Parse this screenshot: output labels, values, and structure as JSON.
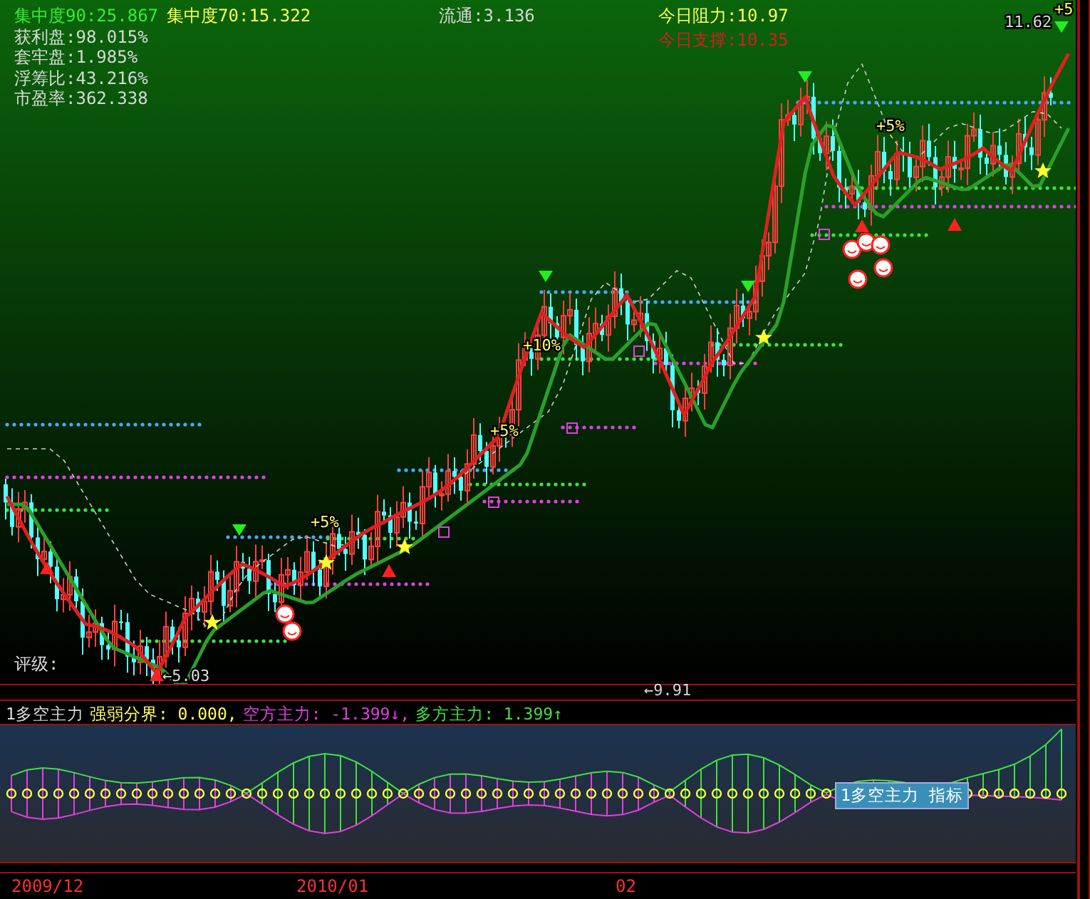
{
  "header": {
    "concentration_90": "集中度90:25.867",
    "concentration_70": "集中度70:15.322",
    "float": "流通:3.136"
  },
  "stats": [
    "获利盘:98.015%",
    "套牢盘:1.985%",
    "浮筹比:43.216%",
    "市盈率:362.338"
  ],
  "resistance": "今日阻力:10.97",
  "support": "今日支撑:10.35",
  "chart_labels": [
    "+5%",
    "+5%",
    "+10%",
    "+5%",
    "+5"
  ],
  "high_price": "11.62",
  "low_price": "←5.03",
  "last_price": "←9.91",
  "rating": "评级:",
  "indicator": {
    "name": "1多空主力",
    "segments": [
      {
        "kind": "neutral",
        "text": "强弱分界: 0.000,"
      },
      {
        "kind": "short",
        "text": "空方主力: -1.399↓,"
      },
      {
        "kind": "long",
        "text": "多方主力: 1.399↑"
      }
    ],
    "tooltip": "1多空主力 指标"
  },
  "axis_dates": [
    "2009/12",
    "2010/01",
    "02"
  ]
}
